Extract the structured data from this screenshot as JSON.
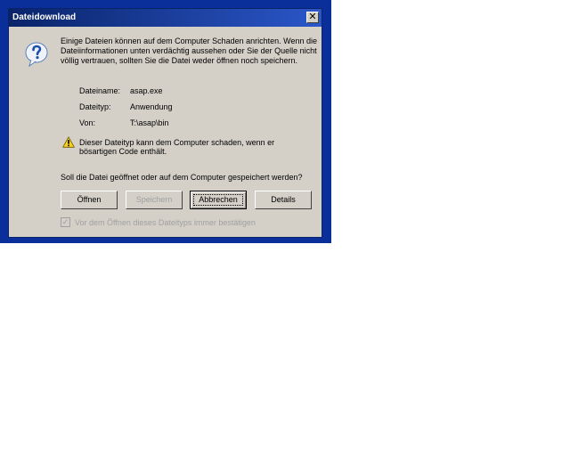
{
  "window": {
    "title": "Dateidownload",
    "close_glyph": "✕"
  },
  "intro_text": "Einige Dateien können auf dem Computer Schaden anrichten. Wenn die Dateiinformationen unten verdächtig aussehen oder Sie der Quelle nicht völlig vertrauen, sollten Sie die Datei weder öffnen noch speichern.",
  "file_info": [
    {
      "label": "Dateiname:",
      "value": "asap.exe"
    },
    {
      "label": "Dateityp:",
      "value": "Anwendung"
    },
    {
      "label": "Von:",
      "value": "T:\\asap\\bin"
    }
  ],
  "warning_text": "Dieser Dateityp kann dem Computer schaden, wenn er bösartigen Code enthält.",
  "question_text": "Soll die Datei geöffnet oder auf dem Computer gespeichert werden?",
  "buttons": {
    "open_label": "Öffnen",
    "save_label": "Speichern",
    "cancel_label": "Abbrechen",
    "details_label": "Details"
  },
  "checkbox": {
    "label": "Vor dem Öffnen dieses Dateityps immer bestätigen",
    "checked": true,
    "check_glyph": "✓"
  },
  "icons": {
    "question": "question-icon",
    "warning": "warning-icon"
  },
  "colors": {
    "titlebar": "#0a246a",
    "dialog_bg": "#d4d0c8",
    "desktop": "#0b2f9a"
  }
}
